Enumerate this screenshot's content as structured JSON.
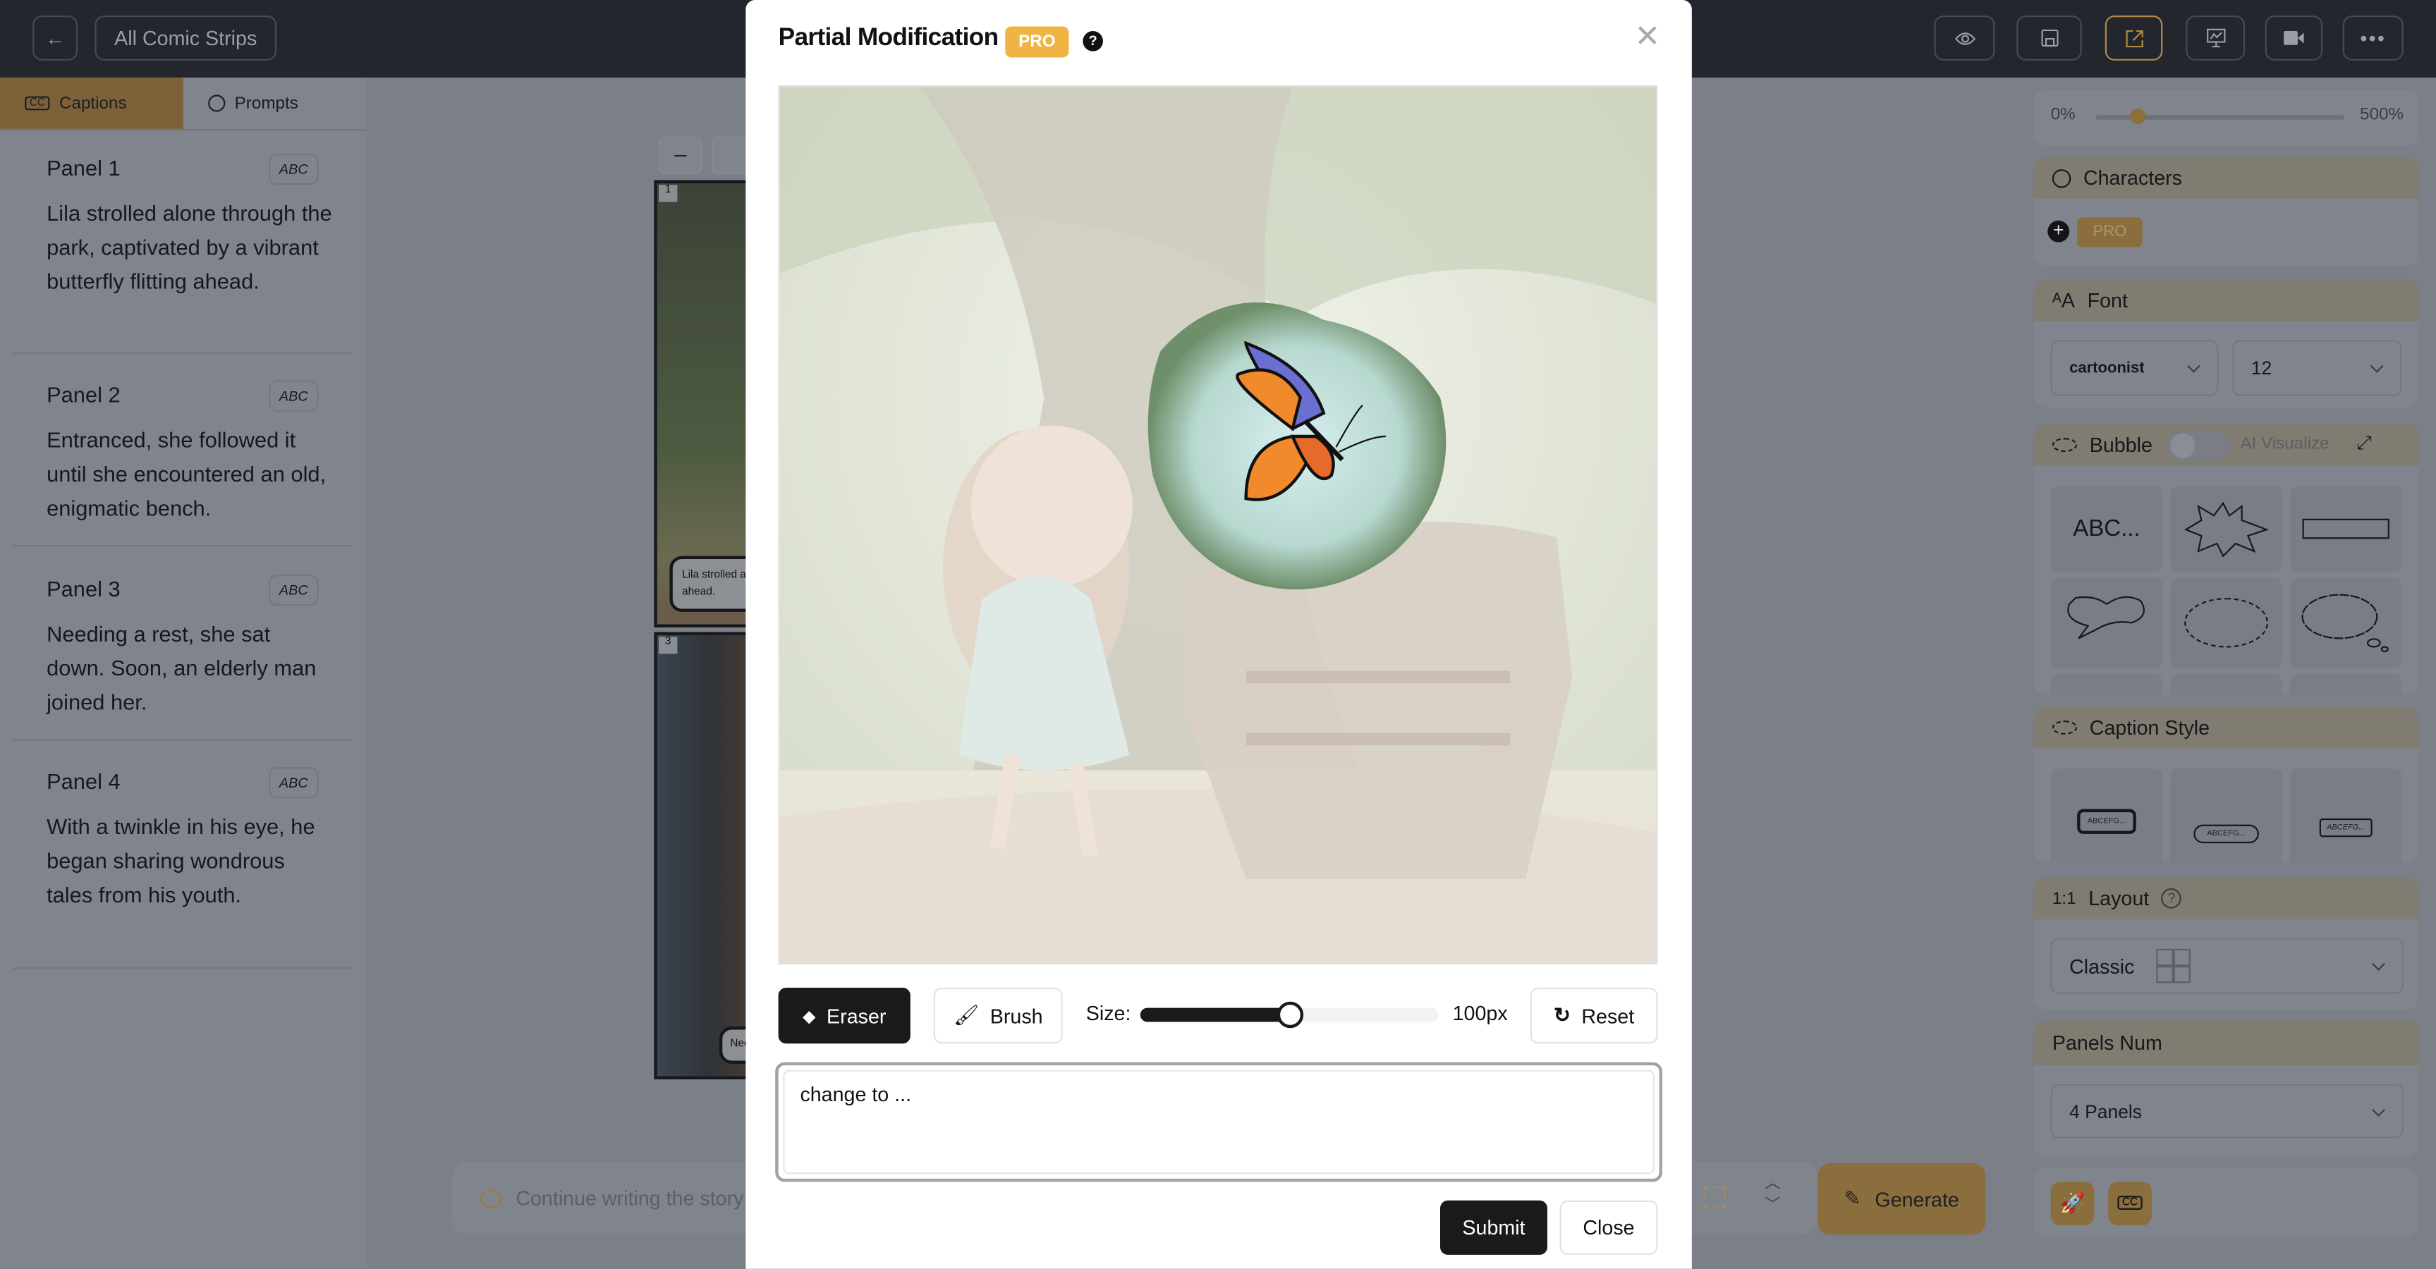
{
  "topbar": {
    "back_icon": "arrow-left-icon",
    "all_strips_label": "All Comic Strips",
    "actions": [
      {
        "name": "preview",
        "icon": "eye-icon"
      },
      {
        "name": "save",
        "icon": "save-icon"
      },
      {
        "name": "share",
        "icon": "external-link-icon"
      },
      {
        "name": "present",
        "icon": "presentation-icon"
      },
      {
        "name": "video",
        "icon": "video-icon"
      },
      {
        "name": "more",
        "icon": "more-icon"
      }
    ]
  },
  "left": {
    "tabs": [
      {
        "label": "Captions",
        "icon": "cc-icon",
        "active": true
      },
      {
        "label": "Prompts",
        "icon": "bulb-icon"
      }
    ],
    "panels": [
      {
        "title": "Panel 1",
        "badge": "ABC",
        "text": "Lila strolled alone through the park, captivated by a vibrant butterfly flitting ahead."
      },
      {
        "title": "Panel 2",
        "badge": "ABC",
        "text": "Entranced, she followed it until she encountered an old, enigmatic bench."
      },
      {
        "title": "Panel 3",
        "badge": "ABC",
        "text": "Needing a rest, she sat down. Soon, an elderly man joined her."
      },
      {
        "title": "Panel 4",
        "badge": "ABC",
        "text": "With a twinkle in his eye, he began sharing wondrous tales from his youth."
      }
    ]
  },
  "canvas": {
    "panel_numbers": [
      "1",
      "3"
    ],
    "caption_snippets": [
      "Lila strolled al",
      "ahead.",
      "Nee"
    ],
    "prompt_placeholder": "Continue writing the story",
    "generate_label": "Generate"
  },
  "right": {
    "zoom": {
      "min": "0%",
      "max": "500%",
      "value_fraction": 0.17
    },
    "characters": {
      "title": "Characters",
      "pro": "PRO"
    },
    "font": {
      "title": "Font",
      "family": "cartoonist",
      "size": "12"
    },
    "bubble": {
      "title": "Bubble",
      "ai_visualize": "AI Visualize",
      "toggle_on": false,
      "abc": "ABC..."
    },
    "caption_style": {
      "title": "Caption Style",
      "samples": [
        "ABCEFG...",
        "ABCEFG...",
        "ABCEFG..."
      ]
    },
    "layout": {
      "ratio": "1:1",
      "title": "Layout",
      "value": "Classic"
    },
    "panels_num": {
      "title": "Panels Num",
      "value": "4 Panels"
    }
  },
  "modal": {
    "title": "Partial Modification",
    "pro": "PRO",
    "eraser": "Eraser",
    "brush": "Brush",
    "size_label": "Size:",
    "size_value": "100px",
    "size_fraction": 0.5,
    "reset": "Reset",
    "prompt_value": "change to ...",
    "submit": "Submit",
    "close": "Close"
  },
  "colors": {
    "accent": "#f0b445",
    "dark": "#1a1a1a"
  }
}
